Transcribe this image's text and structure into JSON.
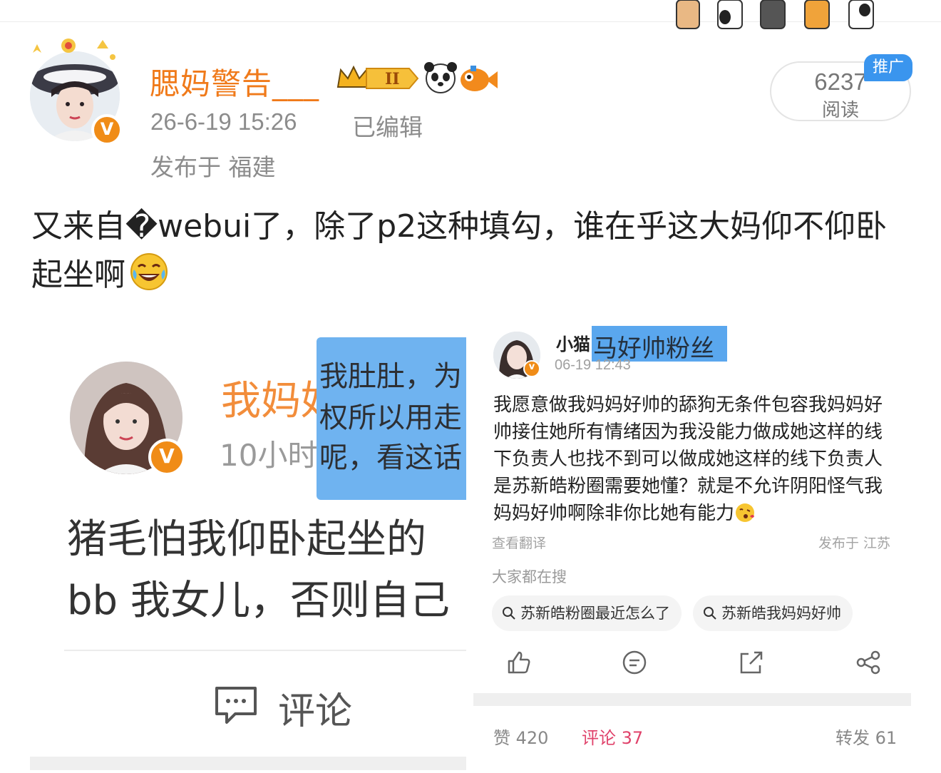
{
  "post": {
    "username": "腮妈警告___",
    "timestamp": "26-6-19 15:26",
    "edited": "已编辑",
    "location": "发布于 福建",
    "read_count": "6237",
    "read_label": "阅读",
    "promo_tag": "推广",
    "text": "又来自�webui了，除了p2这种填勾，谁在乎这大妈仰不仰卧起坐啊",
    "badges": [
      "crown-level-icon",
      "panda-icon",
      "fish-icon"
    ],
    "vip_badge": "V"
  },
  "left_screenshot": {
    "name_partial": "我妈好",
    "time_partial": "10小时",
    "vip_badge": "V",
    "overlay_lines": [
      "我肚肚，为",
      "权所以用走",
      "呢，看这话"
    ],
    "body_line1": "猪毛怕我仰卧起坐的",
    "body_line2": "bb 我女儿，否则自己",
    "comment_label": "评论"
  },
  "right_screenshot": {
    "name_start": "小猫",
    "name_highlight": "马好帅粉丝",
    "time": "06-19 12:43",
    "vip_badge": "v",
    "text": "我愿意做我妈妈好帅的舔狗无条件包容我妈妈好帅接住她所有情绪因为我没能力做成她这样的线下负责人也找不到可以做成她这样的线下负责人 是苏新皓粉圈需要她懂？就是不允许阴阳怪气我妈妈好帅啊除非你比她有能力",
    "translate": "查看翻译",
    "location": "发布于 江苏",
    "searching_label": "大家都在搜",
    "search_chips": [
      "苏新皓粉圈最近怎么了",
      "苏新皓我妈妈好帅"
    ],
    "stats": {
      "likes": "赞 420",
      "comments": "评论 37",
      "reposts": "转发 61"
    }
  },
  "colors": {
    "username_orange": "#f07a1a",
    "promo_blue": "#3a95ee",
    "highlight_blue": "#6fb3f0",
    "comment_active": "#e0436b"
  }
}
